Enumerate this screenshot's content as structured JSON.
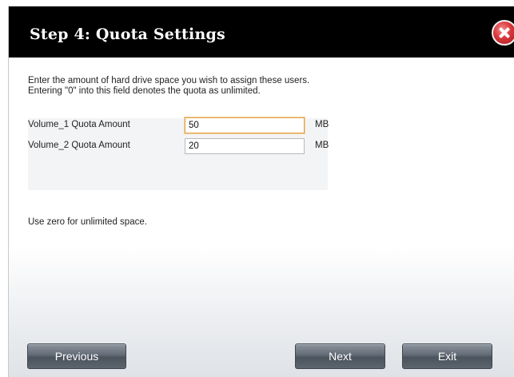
{
  "dialog": {
    "title": "Step 4: Quota Settings",
    "close_icon": "close-icon"
  },
  "description": {
    "line1": "Enter the amount of hard drive space you wish to assign these users.",
    "line2": "Entering \"0\" into this field denotes the quota as unlimited."
  },
  "fields": [
    {
      "label": "Volume_1 Quota Amount",
      "value": "50",
      "unit": "MB"
    },
    {
      "label": "Volume_2 Quota Amount",
      "value": "20",
      "unit": "MB"
    }
  ],
  "hint": "Use zero for unlimited space.",
  "buttons": {
    "previous": "Previous",
    "next": "Next",
    "exit": "Exit"
  },
  "colors": {
    "titlebar": "#000000",
    "close": "#d9373a",
    "focus_border": "#e2a24a"
  }
}
